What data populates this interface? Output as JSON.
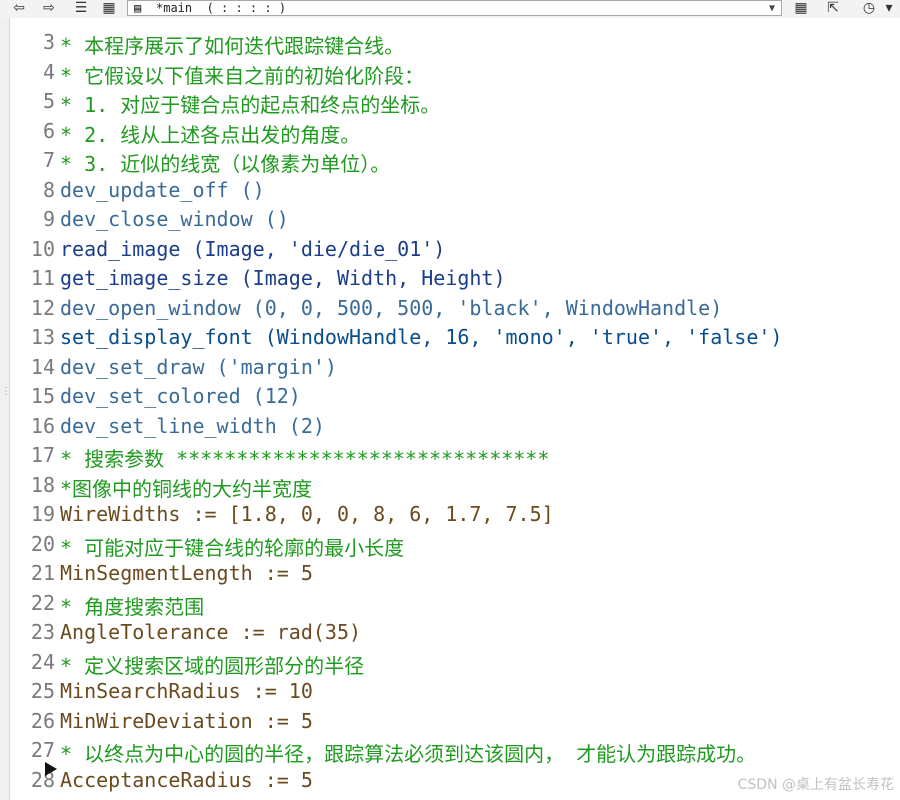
{
  "toolbar": {
    "back_icon": "back-arrow-icon",
    "forward_icon": "forward-arrow-icon",
    "procedure_selector": {
      "icon": "procedure-icon",
      "value": "*main  ( : : : : )"
    },
    "glyphs": {
      "back": "⇦",
      "forward": "⇨",
      "list": "☰",
      "grid": "▦",
      "proc": "▤",
      "dropdown": "▼",
      "calc": "▦",
      "clear": "⇱",
      "gauge": "◷",
      "more": "▾"
    }
  },
  "editor": {
    "lines": [
      {
        "n": "3",
        "text": "* 本程序展示了如何迭代跟踪键合线。",
        "kind": "cmt"
      },
      {
        "n": "4",
        "text": "* 它假设以下值来自之前的初始化阶段：",
        "kind": "cmt"
      },
      {
        "n": "5",
        "text": "* 1. 对应于键合点的起点和终点的坐标。",
        "kind": "cmt"
      },
      {
        "n": "6",
        "text": "* 2. 线从上述各点出发的角度。",
        "kind": "cmt"
      },
      {
        "n": "7",
        "text": "* 3. 近似的线宽（以像素为单位）。",
        "kind": "cmt"
      },
      {
        "n": "8",
        "text": "dev_update_off ()",
        "kind": "op2"
      },
      {
        "n": "9",
        "text": "dev_close_window ()",
        "kind": "op2"
      },
      {
        "n": "10",
        "text": "read_image (Image, 'die/die_01')",
        "kind": "op3"
      },
      {
        "n": "11",
        "text": "get_image_size (Image, Width, Height)",
        "kind": "op3"
      },
      {
        "n": "12",
        "text": "dev_open_window (0, 0, 500, 500, 'black', WindowHandle)",
        "kind": "op2"
      },
      {
        "n": "13",
        "text": "set_display_font (WindowHandle, 16, 'mono', 'true', 'false')",
        "kind": "op"
      },
      {
        "n": "14",
        "text": "dev_set_draw ('margin')",
        "kind": "op2"
      },
      {
        "n": "15",
        "text": "dev_set_colored (12)",
        "kind": "op2"
      },
      {
        "n": "16",
        "text": "dev_set_line_width (2)",
        "kind": "op2"
      },
      {
        "n": "17",
        "text": "* 搜索参数 *******************************",
        "kind": "cmt"
      },
      {
        "n": "18",
        "text": "*图像中的铜线的大约半宽度",
        "kind": "cmt"
      },
      {
        "n": "19",
        "text": "WireWidths := [1.8, 0, 0, 8, 6, 1.7, 7.5]",
        "kind": "asg"
      },
      {
        "n": "20",
        "text": "* 可能对应于键合线的轮廓的最小长度",
        "kind": "cmt"
      },
      {
        "n": "21",
        "text": "MinSegmentLength := 5",
        "kind": "asg"
      },
      {
        "n": "22",
        "text": "* 角度搜索范围",
        "kind": "cmt"
      },
      {
        "n": "23",
        "text": "AngleTolerance := rad(35)",
        "kind": "asg"
      },
      {
        "n": "24",
        "text": "* 定义搜索区域的圆形部分的半径",
        "kind": "cmt"
      },
      {
        "n": "25",
        "text": "MinSearchRadius := 10",
        "kind": "asg"
      },
      {
        "n": "26",
        "text": "MinWireDeviation := 5",
        "kind": "asg"
      },
      {
        "n": "27",
        "text": "* 以终点为中心的圆的半径，跟踪算法必须到达该圆内， 才能认为跟踪成功。",
        "kind": "cmt"
      },
      {
        "n": "28",
        "text": "AcceptanceRadius := 5",
        "kind": "asg"
      }
    ],
    "program_counter_line": "28"
  },
  "watermark": "CSDN @桌上有盆长寿花",
  "colors": {
    "comment": "#1f9a1f",
    "operator": "#0a4d8c",
    "assignment": "#6b4a1e",
    "line_number": "#7a7a7a"
  }
}
